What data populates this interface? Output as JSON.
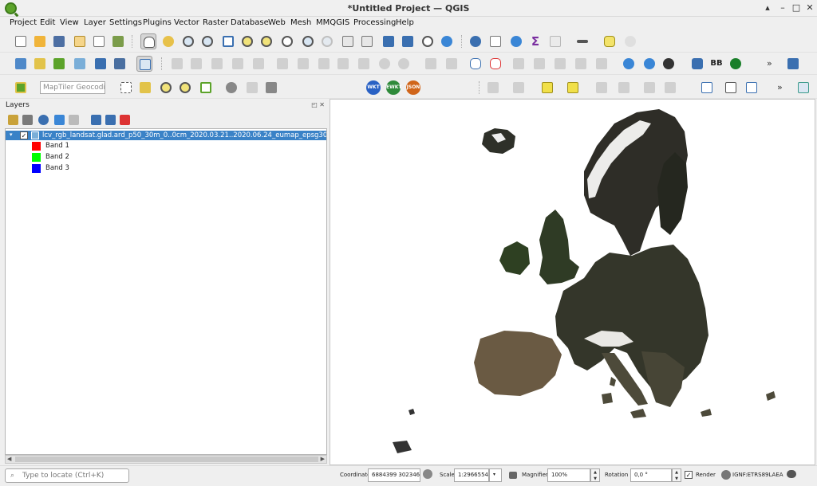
{
  "window": {
    "title": "*Untitled Project — QGIS",
    "controls": {
      "minimize": "▴",
      "restore": "–",
      "maximize": "□",
      "close": "✕"
    }
  },
  "menu": [
    "Project",
    "Edit",
    "View",
    "Layer",
    "Settings",
    "Plugins",
    "Vector",
    "Raster",
    "Database",
    "Web",
    "Mesh",
    "MMQGIS",
    "Processing",
    "Help"
  ],
  "toolbars": {
    "overflow": "»",
    "geocoder_placeholder": "MapTiler Geocodi...",
    "format_badges": [
      "WKT",
      "EWKT",
      "JSON"
    ],
    "bb_label": "BB",
    "sigma": "Σ"
  },
  "layers_panel": {
    "title": "Layers",
    "panel_buttons": "◰ ✕",
    "layer": {
      "name": "lcv_rgb_landsat.glad.ard_p50_30m_0..0cm_2020.03.21..2020.06.24_eumap_epsg3035_v1...",
      "checked": "✓",
      "expander": "▾"
    },
    "bands": [
      {
        "label": "Band 1",
        "color": "#ff0000"
      },
      {
        "label": "Band 2",
        "color": "#00ff00"
      },
      {
        "label": "Band 3",
        "color": "#0000ff"
      }
    ],
    "scroll": {
      "left": "◀",
      "right": "▶"
    }
  },
  "statusbar": {
    "locate_placeholder": "Type to locate (Ctrl+K)",
    "coordinate_label": "Coordinate",
    "coordinate_value": "6884399 3023465",
    "scale_label": "Scale",
    "scale_value": "1:29665548",
    "magnifier_label": "Magnifier",
    "magnifier_value": "100%",
    "rotation_label": "Rotation",
    "rotation_value": "0,0 °",
    "render_label": "Render",
    "render_checked": "✓",
    "crs": "IGNF:ETRS89LAEA",
    "dropdown_arrow": "▾",
    "spin_up": "▲",
    "spin_down": "▼"
  },
  "colors": {
    "selection": "#3a82c7",
    "qgis_green": "#5ca32a"
  }
}
